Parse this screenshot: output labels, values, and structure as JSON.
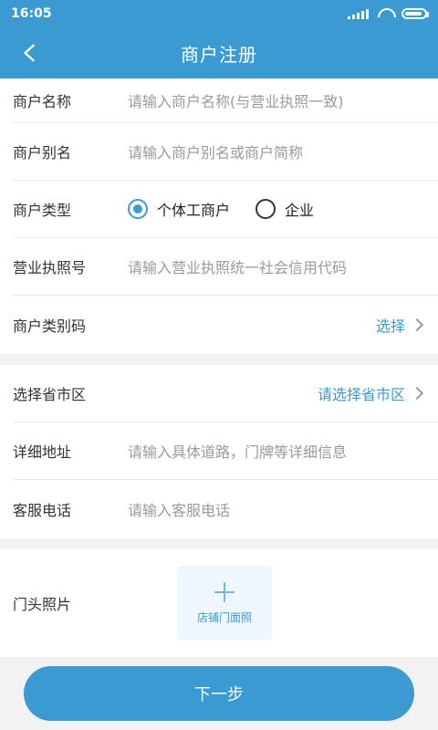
{
  "status_bar": {
    "time": "16:05"
  },
  "header": {
    "title": "商户注册"
  },
  "form": {
    "merchant_name": {
      "label": "商户名称",
      "placeholder": "请输入商户名称(与营业执照一致)"
    },
    "merchant_alias": {
      "label": "商户别名",
      "placeholder": "请输入商户别名或商户简称"
    },
    "merchant_type": {
      "label": "商户类型",
      "options": [
        "个体工商户",
        "企业"
      ],
      "selected": "个体工商户"
    },
    "business_license": {
      "label": "营业执照号",
      "placeholder": "请输入营业执照统一社会信用代码"
    },
    "merchant_category": {
      "label": "商户类别码",
      "value": "选择"
    },
    "region": {
      "label": "选择省市区",
      "value": "请选择省市区"
    },
    "address": {
      "label": "详细地址",
      "placeholder": "请输入具体道路，门牌等详细信息"
    },
    "service_phone": {
      "label": "客服电话",
      "placeholder": "请输入客服电话"
    },
    "storefront_photo": {
      "label": "门头照片",
      "upload_text": "店铺门面照"
    }
  },
  "actions": {
    "next": "下一步"
  },
  "colors": {
    "brand": "#3a9ad1",
    "bg": "#f2f2f2",
    "placeholder": "#9a9a9a"
  }
}
